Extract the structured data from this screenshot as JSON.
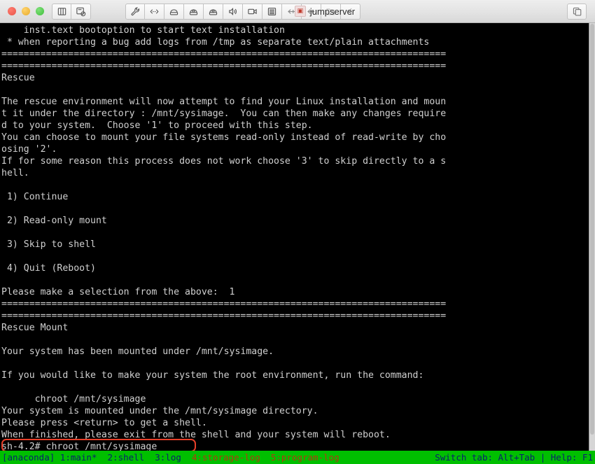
{
  "window": {
    "title": "jumpserver",
    "favicon_glyph": "▣",
    "traffic_lights": [
      "close",
      "minimize",
      "maximize"
    ],
    "toolbar_left": [
      {
        "name": "split-pane-icon",
        "tooltip": "Split Pane"
      },
      {
        "name": "screenshot-icon",
        "tooltip": "Screenshot"
      }
    ],
    "toolbar_mid": [
      {
        "name": "wrench-icon",
        "tooltip": "Tools"
      },
      {
        "name": "code-brackets-icon",
        "tooltip": "Send Command"
      },
      {
        "name": "server-icon",
        "tooltip": "Server"
      },
      {
        "name": "lock-server-icon",
        "tooltip": "Secure Server"
      },
      {
        "name": "key-server-icon",
        "tooltip": "Key Auth"
      },
      {
        "name": "speaker-icon",
        "tooltip": "Sound"
      },
      {
        "name": "video-camera-icon",
        "tooltip": "Record"
      },
      {
        "name": "stack-icon",
        "tooltip": "Layers"
      },
      {
        "name": "transfer-left-icon",
        "tooltip": "Download"
      },
      {
        "name": "transfer-left-2-icon",
        "tooltip": "Upload"
      },
      {
        "name": "folder-sync-icon",
        "tooltip": "Sync Folder"
      },
      {
        "name": "chevron-left-icon",
        "tooltip": "Back"
      }
    ],
    "toolbar_right": [
      {
        "name": "duplicate-window-icon",
        "tooltip": "Duplicate"
      }
    ]
  },
  "terminal": {
    "lines": [
      "    inst.text bootoption to start text installation",
      " * when reporting a bug add logs from /tmp as separate text/plain attachments",
      "================================================================================",
      "================================================================================",
      "Rescue",
      "",
      "The rescue environment will now attempt to find your Linux installation and moun",
      "t it under the directory : /mnt/sysimage.  You can then make any changes require",
      "d to your system.  Choose '1' to proceed with this step.",
      "You can choose to mount your file systems read-only instead of read-write by cho",
      "osing '2'.",
      "If for some reason this process does not work choose '3' to skip directly to a s",
      "hell.",
      "",
      " 1) Continue",
      "",
      " 2) Read-only mount",
      "",
      " 3) Skip to shell",
      "",
      " 4) Quit (Reboot)",
      "",
      "Please make a selection from the above:  1",
      "================================================================================",
      "================================================================================",
      "Rescue Mount",
      "",
      "Your system has been mounted under /mnt/sysimage.",
      "",
      "If you would like to make your system the root environment, run the command:",
      "",
      "      chroot /mnt/sysimage",
      "Your system is mounted under the /mnt/sysimage directory.",
      "Please press <return> to get a shell.",
      "When finished, please exit from the shell and your system will reboot.",
      "sh-4.2# chroot /mnt/sysimage"
    ],
    "highlighted_command": "sh-4.2# chroot /mnt/sysimage",
    "highlight_color": "#e8402a",
    "foreground_color": "#d0d0d0",
    "background_color": "#000000"
  },
  "status_bar": {
    "background_color": "#00bf00",
    "text_color": "#0a1f6e",
    "alert_color": "#b03a10",
    "program": "[anaconda]",
    "tabs": [
      {
        "label": "1:main*",
        "state": "active"
      },
      {
        "label": "2:shell",
        "state": "normal"
      },
      {
        "label": "3:log",
        "state": "normal"
      },
      {
        "label": "4:storage-log",
        "state": "alert"
      },
      {
        "label": "5:program-log",
        "state": "alert"
      }
    ],
    "hints": "Switch tab: Alt+Tab | Help: F1"
  }
}
